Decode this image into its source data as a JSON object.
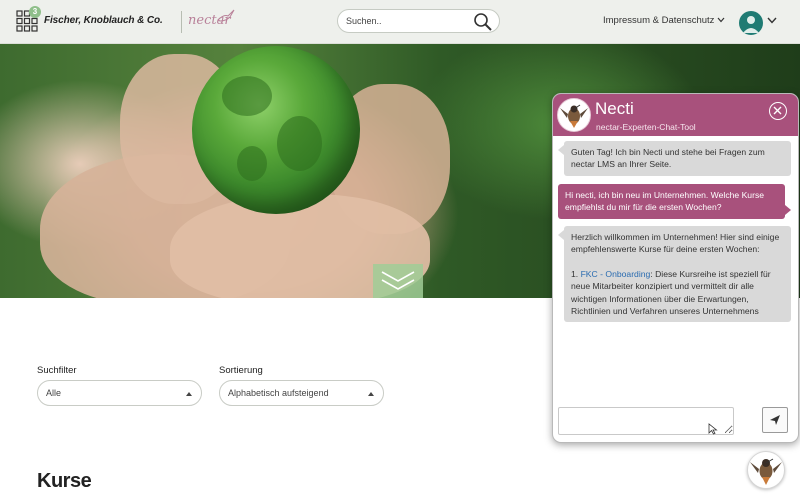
{
  "header": {
    "badge_count": "3",
    "brand": "Fischer, Knoblauch & Co.",
    "nectar_logo": "nectar",
    "search_placeholder": "Suchen..",
    "impressum_label": "Impressum & Datenschutz",
    "icons": [
      "grid-logo-icon",
      "search-icon",
      "chevron-down-icon",
      "user-avatar-icon"
    ],
    "accent": "#a8517c"
  },
  "hero": {
    "scroll_icon": "double-chevron-down-icon",
    "overlay_color": "#a0cd96"
  },
  "filters": {
    "filter_label": "Suchfilter",
    "filter_value": "Alle",
    "sort_label": "Sortierung",
    "sort_value": "Alphabetisch aufsteigend"
  },
  "section": {
    "title": "Kurse"
  },
  "chat": {
    "title": "Necti",
    "subtitle": "nectar-Experten-Chat-Tool",
    "header_color": "#a8517c",
    "messages": [
      {
        "from": "bot",
        "text": "Guten Tag! Ich bin Necti und stehe bei Fragen zum nectar LMS an Ihrer Seite."
      },
      {
        "from": "user",
        "text": "Hi necti, ich bin neu im Unternehmen. Welche Kurse empfiehlst du mir für die ersten Wochen?"
      },
      {
        "from": "bot",
        "intro": "Herzlich willkommen im Unternehmen! Hier sind einige empfehlenswerte Kurse für deine ersten Wochen:",
        "item_number": "1.",
        "item_link": "FKC - Onboarding",
        "item_text": ": Diese Kursreihe ist speziell für neue Mitarbeiter konzipiert und vermittelt dir alle wichtigen Informationen über die Erwartungen, Richtlinien und Verfahren unseres Unternehmens"
      }
    ],
    "input_value": "",
    "icons": [
      "close-icon",
      "send-icon",
      "necti-bird-avatar-icon"
    ]
  }
}
